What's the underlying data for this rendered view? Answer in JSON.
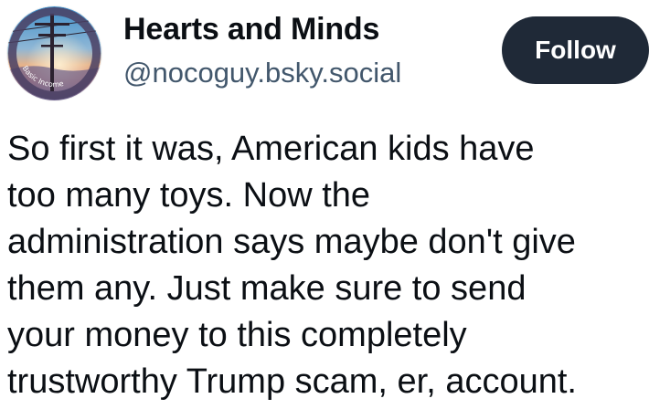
{
  "author": {
    "display_name": "Hearts and Minds",
    "handle": "@nocoguy.bsky.social",
    "avatar_text": "Basic Income"
  },
  "actions": {
    "follow_label": "Follow"
  },
  "post": {
    "text": "So first it was, American kids have\ntoo many toys. Now the\nadministration says maybe don't give\nthem any. Just make sure to send\nyour money to this completely\ntrustworthy Trump scam, er, account."
  },
  "colors": {
    "follow_button_bg": "#1f2937",
    "handle_text": "#42576c",
    "body_text": "#0b0f14"
  }
}
